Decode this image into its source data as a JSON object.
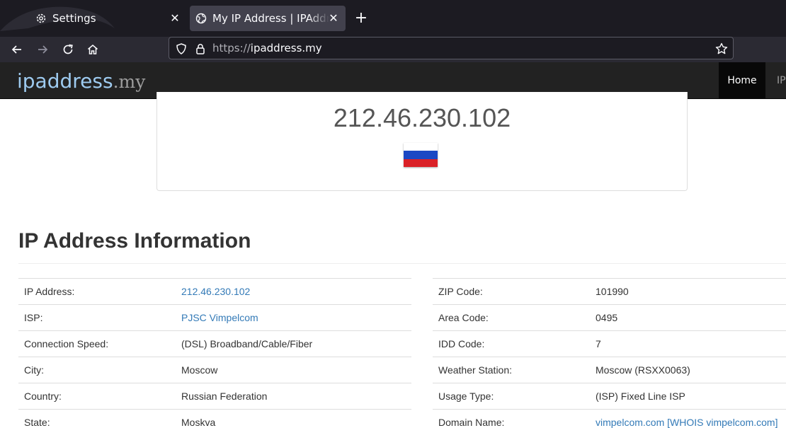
{
  "browser": {
    "tabs": [
      {
        "title": "Settings",
        "icon": "gear-icon"
      },
      {
        "title": "My IP Address | IPAddress.my",
        "icon": "globe-icon",
        "active": true
      }
    ],
    "address_bar": {
      "scheme": "https://",
      "host": "ipaddress.my"
    }
  },
  "site": {
    "brand": {
      "name": "ipaddress",
      "tld": ".my"
    },
    "menu": {
      "home": "Home",
      "ip": "IP"
    }
  },
  "ip_panel": {
    "ip": "212.46.230.102",
    "flag_colors": [
      "#ffffff",
      "#1b48c4",
      "#da2127"
    ]
  },
  "info": {
    "title": "IP Address Information",
    "left": [
      {
        "label": "IP Address:",
        "value": "212.46.230.102",
        "link": true
      },
      {
        "label": "ISP:",
        "value": "PJSC Vimpelcom",
        "link": true
      },
      {
        "label": "Connection Speed:",
        "value": "(DSL) Broadband/Cable/Fiber",
        "link": false
      },
      {
        "label": "City:",
        "value": "Moscow",
        "link": false
      },
      {
        "label": "Country:",
        "value": "Russian Federation",
        "link": false
      },
      {
        "label": "State:",
        "value": "Moskva",
        "link": false
      }
    ],
    "right": [
      {
        "label": "ZIP Code:",
        "value": "101990",
        "link": false
      },
      {
        "label": "Area Code:",
        "value": "0495",
        "link": false
      },
      {
        "label": "IDD Code:",
        "value": "7",
        "link": false
      },
      {
        "label": "Weather Station:",
        "value": "Moscow (RSXX0063)",
        "link": false
      },
      {
        "label": "Usage Type:",
        "value": "(ISP) Fixed Line ISP",
        "link": false
      },
      {
        "label": "Domain Name:",
        "value": "vimpelcom.com [WHOIS vimpelcom.com]",
        "link": true
      }
    ]
  },
  "colors": {
    "link": "#337ab7",
    "header_bg": "#222222",
    "brand": "#9ecbf0"
  }
}
